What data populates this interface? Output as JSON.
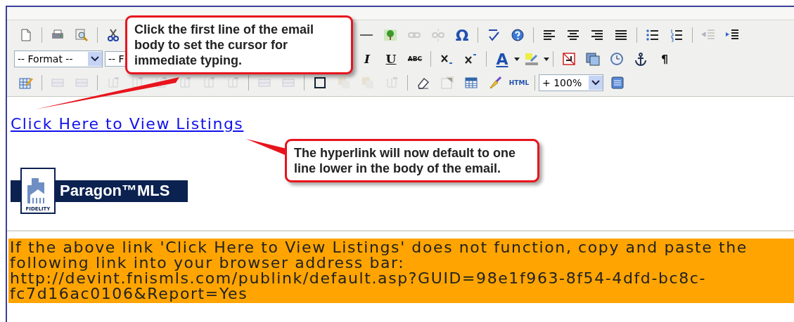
{
  "toolbar": {
    "rows": [
      {
        "items": [
          {
            "kind": "icon",
            "disabled": false
          },
          {
            "kind": "separator"
          },
          {
            "kind": "icon",
            "disabled": false
          },
          {
            "kind": "icon",
            "disabled": false
          },
          {
            "kind": "separator"
          },
          {
            "kind": "icon",
            "disabled": false
          },
          {
            "kind": "hidden"
          },
          {
            "kind": "icon",
            "disabled": false
          },
          {
            "kind": "icon",
            "disabled": true
          },
          {
            "kind": "icon",
            "disabled": true
          },
          {
            "kind": "glyph",
            "label": "Ω",
            "disabled": false
          },
          {
            "kind": "separator"
          },
          {
            "kind": "icon",
            "disabled": false
          },
          {
            "kind": "icon",
            "disabled": false
          },
          {
            "kind": "separator"
          },
          {
            "kind": "icon",
            "disabled": false
          },
          {
            "kind": "icon",
            "disabled": false
          },
          {
            "kind": "icon",
            "disabled": false
          },
          {
            "kind": "icon",
            "disabled": false
          },
          {
            "kind": "separator"
          },
          {
            "kind": "icon",
            "disabled": false
          },
          {
            "kind": "icon",
            "disabled": false
          },
          {
            "kind": "separator"
          },
          {
            "kind": "icon",
            "disabled": true
          },
          {
            "kind": "icon",
            "disabled": false
          }
        ]
      },
      {
        "items": [
          {
            "kind": "select",
            "value": "-- Format --"
          },
          {
            "kind": "select_cut",
            "value": "-- F"
          },
          {
            "kind": "hidden"
          },
          {
            "kind": "glyph",
            "label": "I",
            "disabled": false
          },
          {
            "kind": "glyph",
            "label": "U",
            "disabled": false
          },
          {
            "kind": "glyph",
            "label": "ABC",
            "disabled": false
          },
          {
            "kind": "separator"
          },
          {
            "kind": "icon",
            "disabled": false
          },
          {
            "kind": "icon",
            "disabled": false
          },
          {
            "kind": "separator"
          },
          {
            "kind": "glyph",
            "label": "A",
            "disabled": false
          },
          {
            "kind": "icon",
            "disabled": false
          },
          {
            "kind": "separator"
          },
          {
            "kind": "icon",
            "disabled": false
          },
          {
            "kind": "icon",
            "disabled": false
          },
          {
            "kind": "icon",
            "disabled": false
          },
          {
            "kind": "icon",
            "disabled": false
          },
          {
            "kind": "glyph",
            "label": "¶",
            "disabled": false
          }
        ]
      },
      {
        "items": [
          {
            "kind": "icon",
            "disabled": false
          },
          {
            "kind": "separator"
          },
          {
            "kind": "icon",
            "disabled": true
          },
          {
            "kind": "icon",
            "disabled": true
          },
          {
            "kind": "separator"
          },
          {
            "kind": "icon",
            "disabled": true
          },
          {
            "kind": "icon",
            "disabled": true
          },
          {
            "kind": "icon",
            "disabled": true
          },
          {
            "kind": "icon",
            "disabled": true
          },
          {
            "kind": "icon",
            "disabled": true
          },
          {
            "kind": "icon",
            "disabled": true
          },
          {
            "kind": "separator"
          },
          {
            "kind": "icon",
            "disabled": true
          },
          {
            "kind": "icon",
            "disabled": true
          },
          {
            "kind": "separator"
          },
          {
            "kind": "icon",
            "disabled": false
          },
          {
            "kind": "icon",
            "disabled": true
          },
          {
            "kind": "icon",
            "disabled": true
          },
          {
            "kind": "icon",
            "disabled": true
          },
          {
            "kind": "separator"
          },
          {
            "kind": "icon",
            "disabled": false
          },
          {
            "kind": "icon",
            "disabled": true
          },
          {
            "kind": "icon",
            "disabled": false
          },
          {
            "kind": "icon",
            "disabled": false
          },
          {
            "kind": "glyph",
            "label": "HTML",
            "disabled": false
          },
          {
            "kind": "separator"
          },
          {
            "kind": "select",
            "value": "+ 100%"
          },
          {
            "kind": "icon",
            "disabled": false
          }
        ]
      }
    ]
  },
  "body": {
    "link": "Click Here to View Listings",
    "logo": {
      "name": "Paragon™MLS",
      "tagline": "FIDELITY"
    }
  },
  "notice": {
    "message": "If the above link 'Click Here to View Listings' does not function, copy and paste the following link into your browser address bar:",
    "url": "http://devint.fnismls.com/publink/default.asp?GUID=98e1f963-8f54-4dfd-bc8c-fc7d16ac0106&Report=Yes"
  },
  "callouts": [
    {
      "text": "Click the first line of the email body to set the cursor for immediate typing."
    },
    {
      "text": "The hyperlink will now default to one line lower in the body of the email."
    }
  ]
}
